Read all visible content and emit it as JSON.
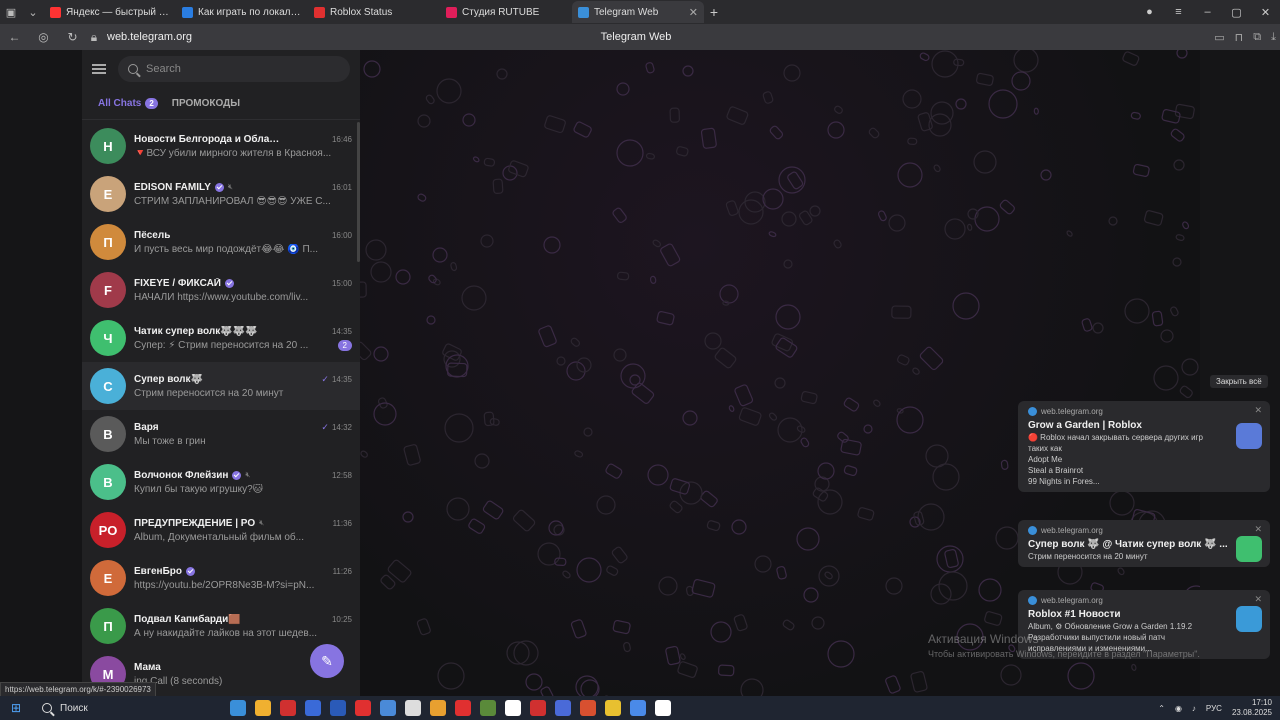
{
  "browser": {
    "tabs": [
      {
        "title": "Яндекс — быстрый поиск",
        "color": "#ff3333",
        "active": false
      },
      {
        "title": "Как играть по локальной",
        "color": "#2a7de1",
        "active": false
      },
      {
        "title": "Roblox Status",
        "color": "#e03030",
        "active": false
      },
      {
        "title": "Студия RUTUBE",
        "color": "#e01e5a",
        "active": false
      },
      {
        "title": "Telegram Web",
        "color": "#3a8fd9",
        "active": true
      }
    ],
    "address": "web.telegram.org",
    "page_title": "Telegram Web"
  },
  "sidebar": {
    "search_placeholder": "Search",
    "folders": [
      {
        "label": "All Chats",
        "badge": "2",
        "active": true
      },
      {
        "label": "ПРОМОКОДЫ",
        "badge": "",
        "active": false
      }
    ],
    "chats": [
      {
        "name": "Новости Белгорода и Области",
        "time": "16:46",
        "preview": "🔻ВСУ убили мирного жителя в Красноя...",
        "avatar_color": "#3c8c5c",
        "avatar_text": "Н",
        "verified": false,
        "muted": false,
        "unread": "",
        "check": false
      },
      {
        "name": "EDISON FAMILY",
        "time": "16:01",
        "preview": "СТРИМ ЗАПЛАНИРОВАЛ 😎😎😎 УЖЕ С...",
        "avatar_color": "#c9a37a",
        "avatar_text": "E",
        "verified": true,
        "muted": true,
        "unread": "",
        "check": false
      },
      {
        "name": "Пёсель",
        "time": "16:00",
        "preview": "И пусть весь мир подождёт😂😂 🧿 П...",
        "avatar_color": "#d08a3c",
        "avatar_text": "П",
        "verified": false,
        "muted": false,
        "unread": "",
        "check": false
      },
      {
        "name": "FIXEYE / ФИКСАЙ",
        "time": "15:00",
        "preview": "НАЧАЛИ https://www.youtube.com/liv...",
        "avatar_color": "#a03a4a",
        "avatar_text": "F",
        "verified": true,
        "muted": false,
        "unread": "",
        "check": false
      },
      {
        "name": "Чатик супер волк🐺🐺🐺",
        "time": "14:35",
        "preview": "Супер: ⚡ Стрим переносится на 20 ...",
        "avatar_color": "#3fbf6f",
        "avatar_text": "Ч",
        "verified": false,
        "muted": false,
        "unread": "2",
        "check": false
      },
      {
        "name": "Супер волк🐺",
        "time": "14:35",
        "preview": "Стрим переносится на 20 минут",
        "avatar_color": "#4ab0d8",
        "avatar_text": "С",
        "verified": false,
        "muted": false,
        "unread": "",
        "check": true
      },
      {
        "name": "Варя",
        "time": "14:32",
        "preview": "Мы тоже в грин",
        "avatar_color": "#5a5a5a",
        "avatar_text": "В",
        "verified": false,
        "muted": false,
        "unread": "",
        "check": true
      },
      {
        "name": "Волчонок Флейзин",
        "time": "12:58",
        "preview": "Купил бы такую игрушку?🐱",
        "avatar_color": "#4bbf8a",
        "avatar_text": "В",
        "verified": true,
        "muted": true,
        "unread": "",
        "check": false
      },
      {
        "name": "ПРЕДУПРЕЖДЕНИЕ | РО",
        "time": "11:36",
        "preview": "Album, Документальный фильм об...",
        "avatar_color": "#c8202a",
        "avatar_text": "PO",
        "verified": false,
        "muted": true,
        "unread": "",
        "check": false
      },
      {
        "name": "ЕвгенБро",
        "time": "11:26",
        "preview": "https://youtu.be/2OPR8Ne3B-M?si=pN...",
        "avatar_color": "#d06a3a",
        "avatar_text": "Е",
        "verified": true,
        "muted": false,
        "unread": "",
        "check": false
      },
      {
        "name": "Подвал Капибарди🟫",
        "time": "10:25",
        "preview": "А ну накидайте лайков на этот шедев...",
        "avatar_color": "#3a9a4a",
        "avatar_text": "П",
        "verified": false,
        "muted": false,
        "unread": "",
        "check": false
      },
      {
        "name": "Мама",
        "time": "",
        "preview": "ing Call (8 seconds)",
        "avatar_color": "#8a4aa0",
        "avatar_text": "М",
        "verified": false,
        "muted": false,
        "unread": "",
        "check": false
      }
    ]
  },
  "notifications": {
    "close_all": "Закрыть всё",
    "items": [
      {
        "source": "web.telegram.org",
        "title": "Grow a Garden | Roblox",
        "lines": [
          "🔴 Roblox начал закрывать сервера других игр",
          "таких как",
          "Adopt Me",
          "Steal a Brainrot",
          "99 Nights in Fores..."
        ],
        "avatar_color": "#5a7ad8"
      },
      {
        "source": "web.telegram.org",
        "title": "Супер волк 🐺 @ Чатик супер волк 🐺 ...",
        "lines": [
          "Стрим переносится на 20 минут"
        ],
        "avatar_color": "#3fbf6f"
      },
      {
        "source": "web.telegram.org",
        "title": "Roblox #1 Новости",
        "lines": [
          "Album, ⚙ Обновление Grow a Garden 1.19.2",
          "Разработчики выпустили новый патч",
          "исправлениями и изменениями..."
        ],
        "avatar_color": "#3a9ad8"
      }
    ]
  },
  "watermark": {
    "title": "Активация Windows",
    "subtitle": "Чтобы активировать Windows, перейдите в раздел \"Параметры\"."
  },
  "status_url": "https://web.telegram.org/k/#-2390026973",
  "taskbar": {
    "search_label": "Поиск",
    "lang": "РУС",
    "time": "17:10",
    "date": "23.08.2025",
    "apps": [
      "#3a8fd9",
      "#f0b030",
      "#d03030",
      "#3a6ad8",
      "#2a5ab8",
      "#e03030",
      "#4a8ad8",
      "#dddddd",
      "#e8a030",
      "#e03030",
      "#5a8a3a",
      "#ffffff",
      "#d03030",
      "#4a6ad8",
      "#d85030",
      "#e8c030",
      "#4a8ae8",
      "#ffffff"
    ]
  }
}
